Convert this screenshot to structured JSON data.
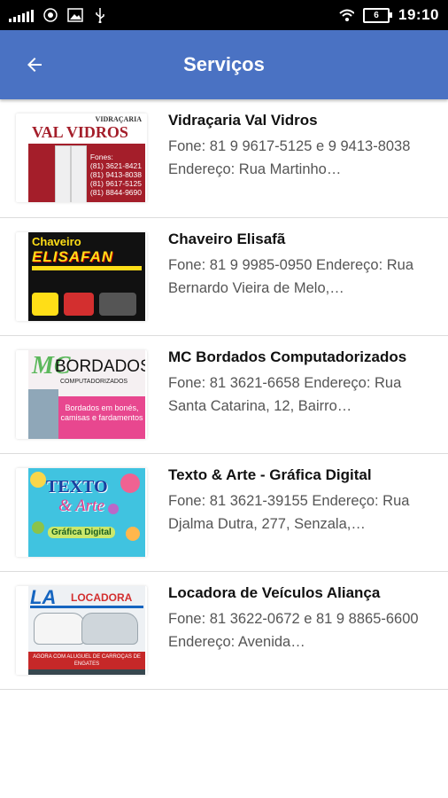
{
  "status_bar": {
    "time": "19:10",
    "battery": "6"
  },
  "app_bar": {
    "title": "Serviços"
  },
  "services": [
    {
      "name": "Vidraçaria Val Vidros",
      "description": "Fone: 81 9 9617-5125 e 9 9413-8038 Endereço: Rua Martinho…",
      "thumb": {
        "brand": "VAL VIDROS",
        "tagline": "VIDRAÇARIA",
        "phones_label": "Fones:",
        "phones": [
          "(81) 3621-8421",
          "(81) 9413-8038",
          "(81) 9617-5125",
          "(81) 8844-9690"
        ]
      }
    },
    {
      "name": "Chaveiro Elisafã",
      "description": "Fone: 81 9 9985-0950 Endereço: Rua Bernardo Vieira de Melo,…",
      "thumb": {
        "line1": "Chaveiro",
        "line2": "ELISAFAN"
      }
    },
    {
      "name": "MC Bordados Computadorizados",
      "description": "Fone: 81 3621-6658 Endereço: Rua Santa Catarina, 12, Bairro…",
      "thumb": {
        "mark": "MC",
        "brand": "BORDADOS",
        "sub": "COMPUTADORIZADOS",
        "pink_text": "Bordados em bonés, camisas e fardamentos"
      }
    },
    {
      "name": "Texto & Arte - Gráfica Digital",
      "description": "Fone: 81 3621-39155 Endereço: Rua Djalma Dutra, 277, Senzala,…",
      "thumb": {
        "line1": "TEXTO",
        "line2": "& Arte",
        "badge": "Gráfica Digital"
      }
    },
    {
      "name": "Locadora de Veículos Aliança",
      "description": "Fone: 81 3622-0672 e 81 9 8865-6600 Endereço: Avenida…",
      "thumb": {
        "mark": "LA",
        "brand": "LOCADORA",
        "banner": "AGORA COM ALUGUEL DE CARROÇAS DE ENGATES"
      }
    }
  ]
}
